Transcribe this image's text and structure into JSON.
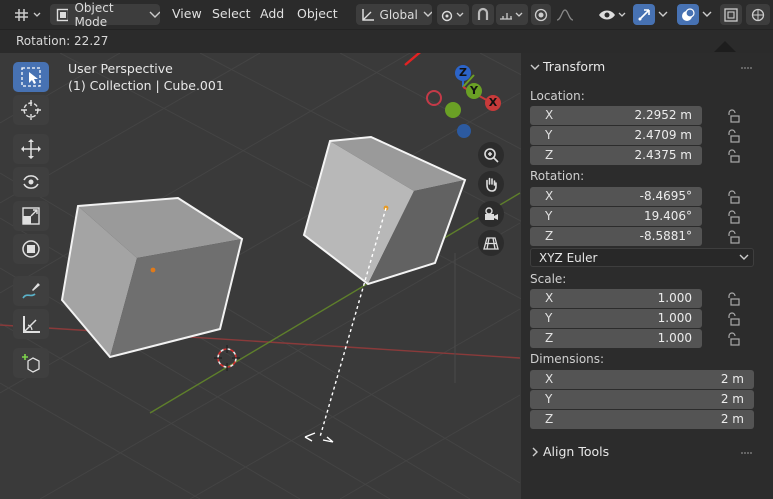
{
  "header": {
    "mode_label": "Object Mode",
    "menus": [
      "View",
      "Select",
      "Add",
      "Object"
    ],
    "orientation_label": "Global",
    "icons": [
      "editor-type-icon",
      "object-mode-icon",
      "transform-orientation-icon",
      "pivot-point-icon",
      "snap-icon",
      "snap-target-icon",
      "proportional-edit-icon",
      "falloff-icon",
      "visibility-icon",
      "gizmo-icon",
      "overlay-icon",
      "xray-icon",
      "wireframe-shading-icon",
      "solid-shading-icon"
    ]
  },
  "status": {
    "operator_text": "Rotation: 22.27"
  },
  "viewport": {
    "perspective": "User Perspective",
    "collection_info": "(1) Collection | Cube.001",
    "gizmo_axes": {
      "x": "X",
      "y": "Y",
      "z": "Z"
    },
    "annotation_color": "#e32222"
  },
  "sidebar": {
    "panel_title": "Transform",
    "location_label": "Location:",
    "location": [
      {
        "axis": "X",
        "value": "2.2952 m"
      },
      {
        "axis": "Y",
        "value": "2.4709 m"
      },
      {
        "axis": "Z",
        "value": "2.4375 m"
      }
    ],
    "rotation_label": "Rotation:",
    "rotation": [
      {
        "axis": "X",
        "value": "-8.4695°"
      },
      {
        "axis": "Y",
        "value": "19.406°"
      },
      {
        "axis": "Z",
        "value": "-8.5881°"
      }
    ],
    "rotation_mode": "XYZ Euler",
    "scale_label": "Scale:",
    "scale": [
      {
        "axis": "X",
        "value": "1.000"
      },
      {
        "axis": "Y",
        "value": "1.000"
      },
      {
        "axis": "Z",
        "value": "1.000"
      }
    ],
    "dimensions_label": "Dimensions:",
    "dimensions": [
      {
        "axis": "X",
        "value": "2 m"
      },
      {
        "axis": "Y",
        "value": "2 m"
      },
      {
        "axis": "Z",
        "value": "2 m"
      }
    ],
    "align_tools_title": "Align Tools"
  }
}
